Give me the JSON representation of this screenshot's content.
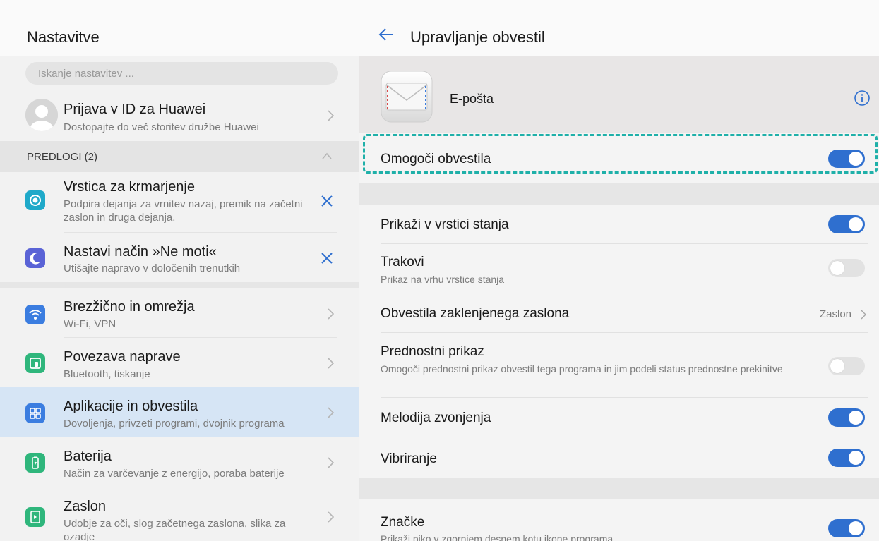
{
  "left": {
    "title": "Nastavitve",
    "search": {
      "placeholder": "Iskanje nastavitev ..."
    },
    "account": {
      "title": "Prijava v ID za Huawei",
      "subtitle": "Dostopajte do več storitev družbe Huawei"
    },
    "suggestions": {
      "label": "PREDLOGI (2)",
      "items": [
        {
          "title": "Vrstica za krmarjenje",
          "subtitle": "Podpira dejanja za vrnitev nazaj, premik na začetni zaslon in druga dejanja.",
          "icon": "navigation-bar-icon"
        },
        {
          "title": "Nastavi način »Ne moti«",
          "subtitle": "Utišajte napravo v določenih trenutkih",
          "icon": "moon-icon"
        }
      ]
    },
    "items": [
      {
        "title": "Brezžično in omrežja",
        "subtitle": "Wi-Fi, VPN",
        "icon": "wifi-icon",
        "color": "#3b7de0"
      },
      {
        "title": "Povezava naprave",
        "subtitle": "Bluetooth, tiskanje",
        "icon": "device-connection-icon",
        "color": "#2fb67c"
      },
      {
        "title": "Aplikacije in obvestila",
        "subtitle": "Dovoljenja, privzeti programi, dvojnik programa",
        "icon": "apps-icon",
        "color": "#3b7de0",
        "selected": true
      },
      {
        "title": "Baterija",
        "subtitle": "Način za varčevanje z energijo, poraba baterije",
        "icon": "battery-icon",
        "color": "#2fb67c"
      },
      {
        "title": "Zaslon",
        "subtitle": "Udobje za oči, slog začetnega zaslona, slika za ozadje",
        "icon": "display-icon",
        "color": "#2fb67c"
      }
    ]
  },
  "right": {
    "title": "Upravljanje obvestil",
    "app": {
      "name": "E-pošta",
      "icon": "email-app-icon"
    },
    "main_toggle": {
      "label": "Omogoči obvestila",
      "on": true
    },
    "rows": [
      {
        "label": "Prikaži v vrstici stanja",
        "on": true
      },
      {
        "label": "Trakovi",
        "subtitle": "Prikaz na vrhu vrstice stanja",
        "on": false
      },
      {
        "label": "Obvestila zaklenjenega zaslona",
        "value": "Zaslon"
      },
      {
        "label": "Prednostni prikaz",
        "subtitle": "Omogoči prednostni prikaz obvestil tega programa in jim podeli status prednostne prekinitve",
        "on": false
      },
      {
        "label": "Melodija zvonjenja",
        "on": true
      },
      {
        "label": "Vibriranje",
        "on": true
      }
    ],
    "badges": {
      "label": "Značke",
      "subtitle": "Prikaži piko v zgornjem desnem kotu ikone programa",
      "on": true
    }
  },
  "colors": {
    "accent": "#2f6fcf",
    "highlight_border": "#1fb0a9",
    "selected_row": "#d6e5f5"
  }
}
